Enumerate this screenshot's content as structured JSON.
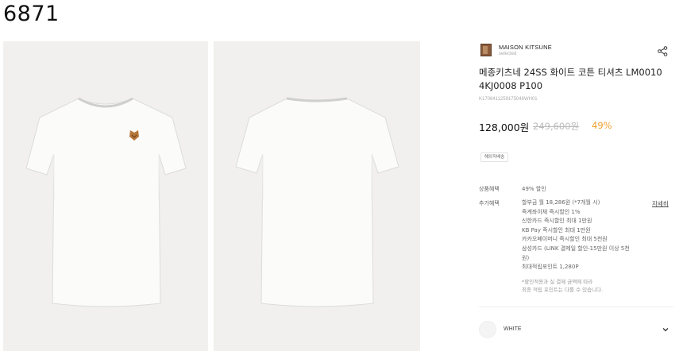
{
  "product_id_label": "6871",
  "images": [
    {
      "alt": "front",
      "icon": "tshirt-front-icon"
    },
    {
      "alt": "back",
      "icon": "tshirt-back-icon"
    }
  ],
  "brand": {
    "name": "MAISON KITSUNE",
    "subtitle": "selected",
    "logo_color": "#8a5a3b"
  },
  "product": {
    "title": "메종키츠네 24SS 화이트 코튼 티셔츠 LM0010 4KJ0008 P100",
    "sku": "K1708411259175048WH01",
    "price": "128,000원",
    "original_price": "249,600원",
    "discount": "49%",
    "discount_color": "#f0a030",
    "tag": "해외직배송"
  },
  "benefits": {
    "label": "상품혜택",
    "value": "49% 할인"
  },
  "extra_benefits": {
    "label": "추가혜택",
    "detail_link": "자세히",
    "items": [
      "할부금 월 18,286원 (*7개월 시)",
      "즉계좌이체 즉시할인 1%",
      "신한카드 즉시할인 최대 1만원",
      "KB Pay 즉시할인 최대 1만원",
      "카카오페이머니 즉시할인 최대 5천원",
      "삼성카드 (LINK 결제일 할인-15만원 이상 5천",
      "원)",
      "최대적립포인트 1,280P"
    ],
    "notes": [
      "*할인적용과 실 결제 금액에 따라",
      "최종 적립 포인트는 다를 수 있습니다."
    ]
  },
  "option": {
    "color_label": "WHITE"
  }
}
